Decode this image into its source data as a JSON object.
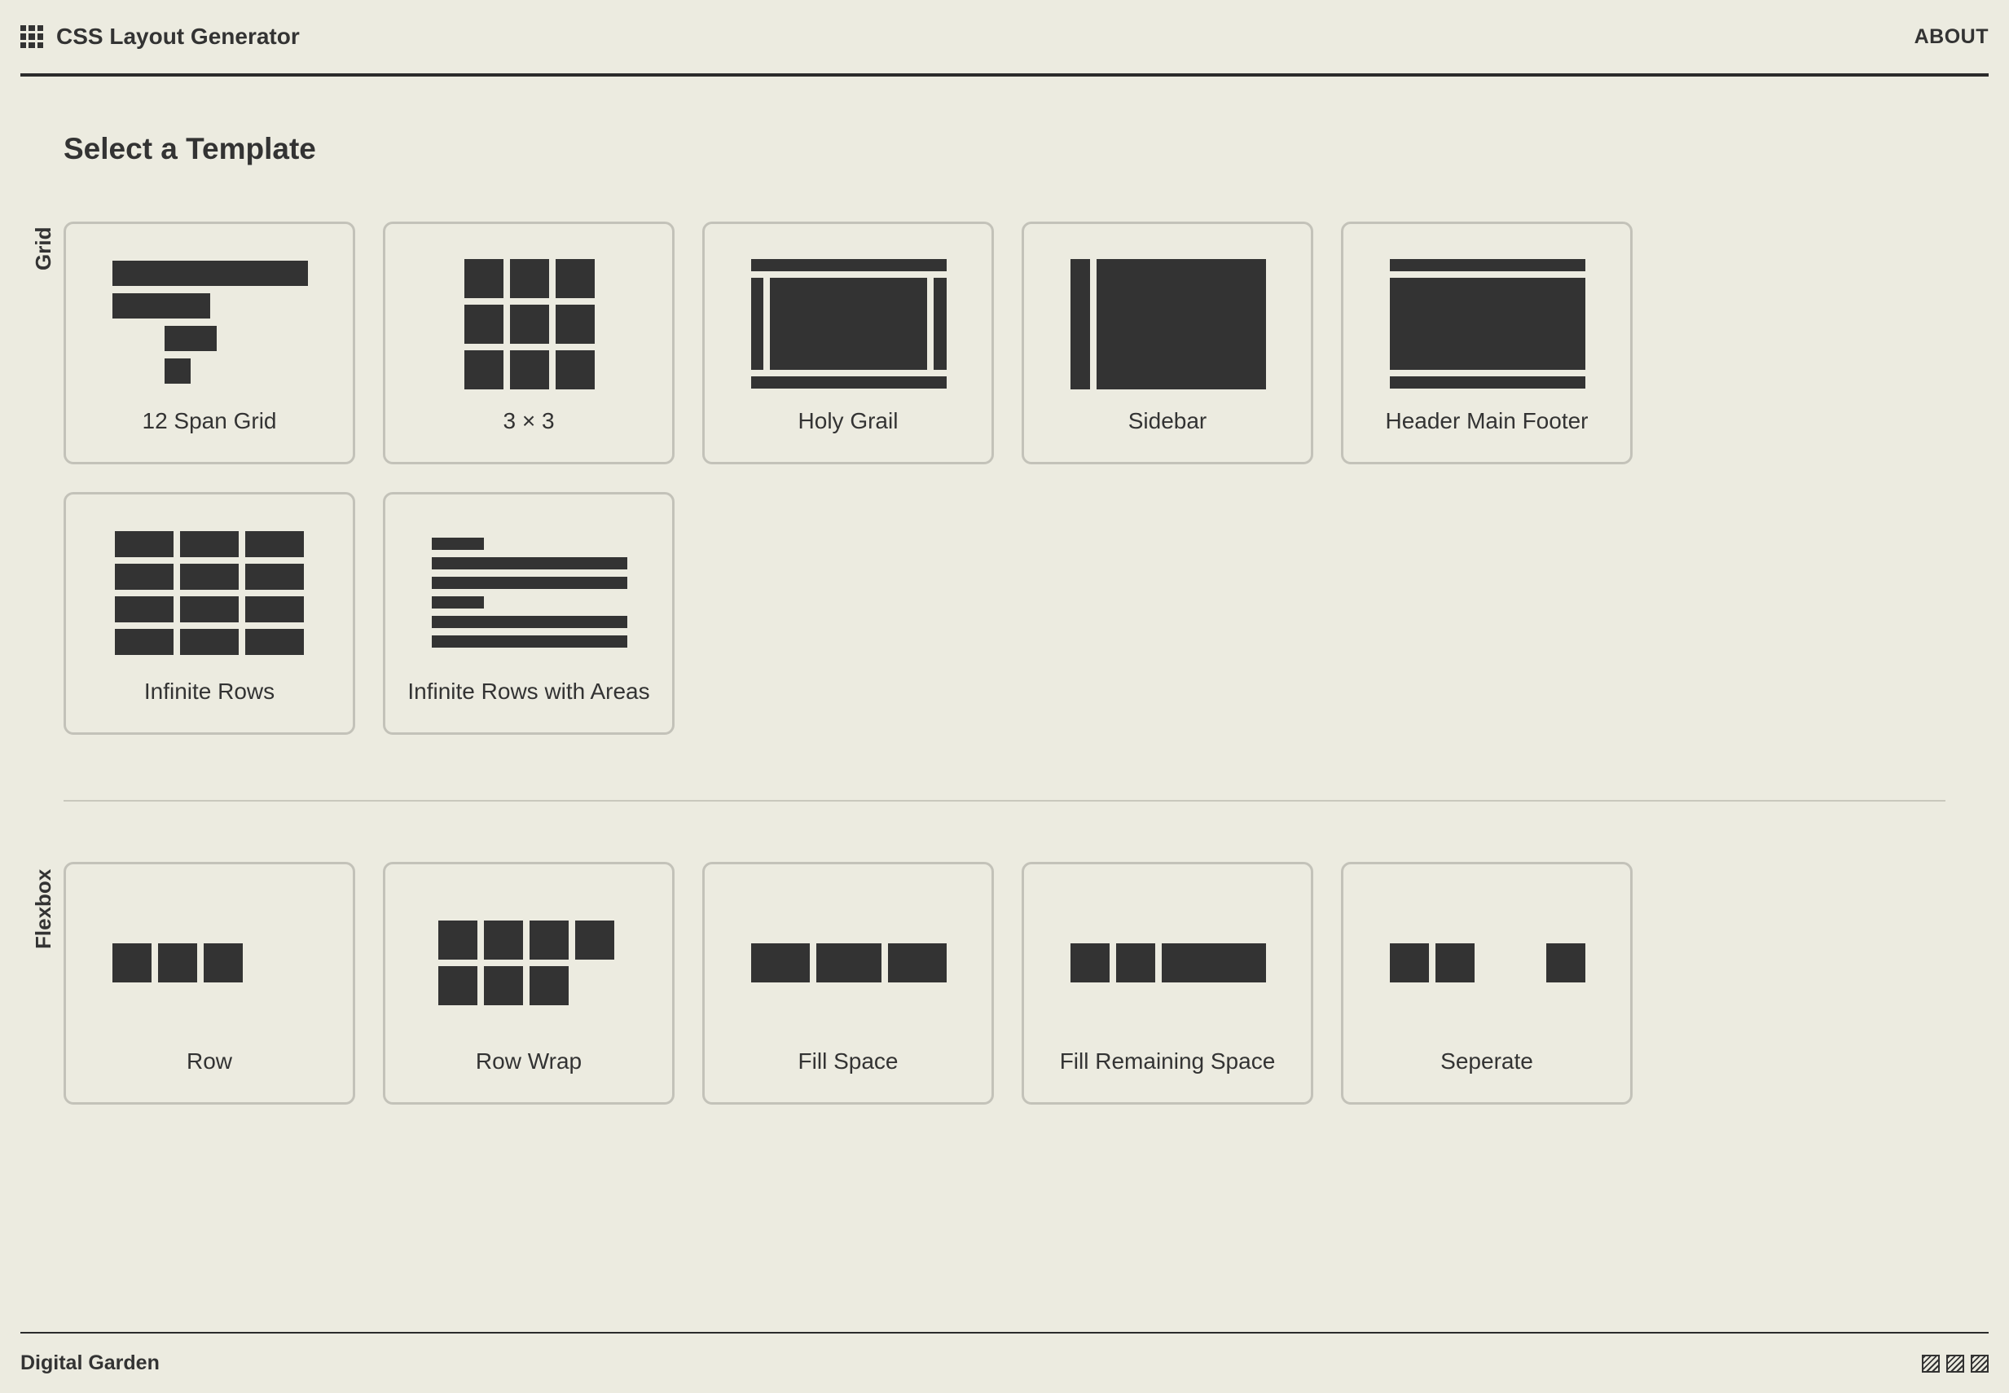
{
  "header": {
    "title": "CSS Layout Generator",
    "about": "ABOUT"
  },
  "main": {
    "title": "Select a Template",
    "grid_label": "Grid",
    "flexbox_label": "Flexbox",
    "grid_templates": [
      {
        "label": "12 Span Grid"
      },
      {
        "label": "3 × 3"
      },
      {
        "label": "Holy Grail"
      },
      {
        "label": "Sidebar"
      },
      {
        "label": "Header Main Footer"
      },
      {
        "label": "Infinite Rows"
      },
      {
        "label": "Infinite Rows with Areas"
      }
    ],
    "flexbox_templates": [
      {
        "label": "Row"
      },
      {
        "label": "Row Wrap"
      },
      {
        "label": "Fill Space"
      },
      {
        "label": "Fill Remaining Space"
      },
      {
        "label": "Seperate"
      }
    ]
  },
  "footer": {
    "brand": "Digital Garden"
  },
  "icons": {
    "brand": "grid-icon",
    "footer": [
      "pattern-swatch-icon",
      "pattern-swatch-icon",
      "pattern-swatch-icon"
    ]
  },
  "colors": {
    "background": "#ecebe0",
    "ink": "#333333",
    "card_border": "#c3c2b9"
  }
}
